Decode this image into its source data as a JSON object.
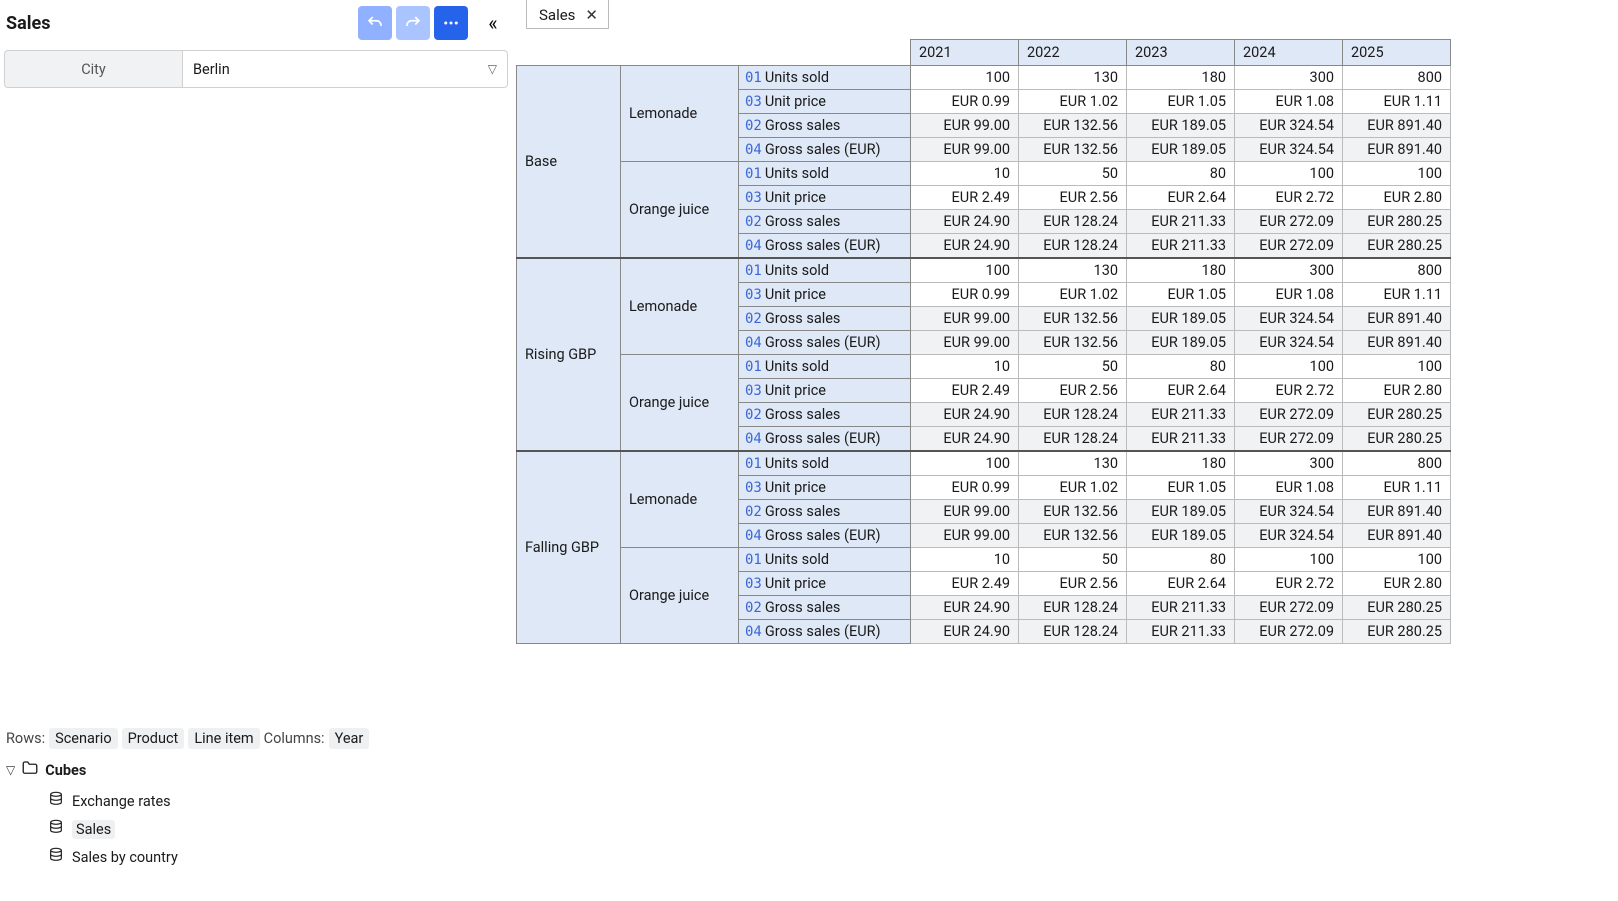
{
  "sidebar": {
    "title": "Sales",
    "filter": {
      "label": "City",
      "value": "Berlin"
    },
    "rows_label": "Rows:",
    "cols_label": "Columns:",
    "row_dims": [
      "Scenario",
      "Product",
      "Line item"
    ],
    "col_dims": [
      "Year"
    ],
    "tree": {
      "root": "Cubes",
      "items": [
        {
          "label": "Exchange rates",
          "selected": false
        },
        {
          "label": "Sales",
          "selected": true
        },
        {
          "label": "Sales by country",
          "selected": false
        }
      ]
    }
  },
  "tab": {
    "label": "Sales"
  },
  "years": [
    "2021",
    "2022",
    "2023",
    "2024",
    "2025"
  ],
  "line_items": [
    {
      "code": "01",
      "label": "Units sold",
      "style": "units"
    },
    {
      "code": "03",
      "label": "Unit price",
      "style": "price"
    },
    {
      "code": "02",
      "label": "Gross sales",
      "style": "calc"
    },
    {
      "code": "04",
      "label": "Gross sales (EUR)",
      "style": "calc"
    }
  ],
  "scenarios": [
    {
      "name": "Base",
      "products": [
        {
          "name": "Lemonade",
          "rows": [
            [
              "100",
              "130",
              "180",
              "300",
              "800"
            ],
            [
              "EUR 0.99",
              "EUR 1.02",
              "EUR 1.05",
              "EUR 1.08",
              "EUR 1.11"
            ],
            [
              "EUR 99.00",
              "EUR 132.56",
              "EUR 189.05",
              "EUR 324.54",
              "EUR 891.40"
            ],
            [
              "EUR 99.00",
              "EUR 132.56",
              "EUR 189.05",
              "EUR 324.54",
              "EUR 891.40"
            ]
          ]
        },
        {
          "name": "Orange juice",
          "rows": [
            [
              "10",
              "50",
              "80",
              "100",
              "100"
            ],
            [
              "EUR 2.49",
              "EUR 2.56",
              "EUR 2.64",
              "EUR 2.72",
              "EUR 2.80"
            ],
            [
              "EUR 24.90",
              "EUR 128.24",
              "EUR 211.33",
              "EUR 272.09",
              "EUR 280.25"
            ],
            [
              "EUR 24.90",
              "EUR 128.24",
              "EUR 211.33",
              "EUR 272.09",
              "EUR 280.25"
            ]
          ]
        }
      ]
    },
    {
      "name": "Rising GBP",
      "products": [
        {
          "name": "Lemonade",
          "rows": [
            [
              "100",
              "130",
              "180",
              "300",
              "800"
            ],
            [
              "EUR 0.99",
              "EUR 1.02",
              "EUR 1.05",
              "EUR 1.08",
              "EUR 1.11"
            ],
            [
              "EUR 99.00",
              "EUR 132.56",
              "EUR 189.05",
              "EUR 324.54",
              "EUR 891.40"
            ],
            [
              "EUR 99.00",
              "EUR 132.56",
              "EUR 189.05",
              "EUR 324.54",
              "EUR 891.40"
            ]
          ]
        },
        {
          "name": "Orange juice",
          "rows": [
            [
              "10",
              "50",
              "80",
              "100",
              "100"
            ],
            [
              "EUR 2.49",
              "EUR 2.56",
              "EUR 2.64",
              "EUR 2.72",
              "EUR 2.80"
            ],
            [
              "EUR 24.90",
              "EUR 128.24",
              "EUR 211.33",
              "EUR 272.09",
              "EUR 280.25"
            ],
            [
              "EUR 24.90",
              "EUR 128.24",
              "EUR 211.33",
              "EUR 272.09",
              "EUR 280.25"
            ]
          ]
        }
      ]
    },
    {
      "name": "Falling GBP",
      "products": [
        {
          "name": "Lemonade",
          "rows": [
            [
              "100",
              "130",
              "180",
              "300",
              "800"
            ],
            [
              "EUR 0.99",
              "EUR 1.02",
              "EUR 1.05",
              "EUR 1.08",
              "EUR 1.11"
            ],
            [
              "EUR 99.00",
              "EUR 132.56",
              "EUR 189.05",
              "EUR 324.54",
              "EUR 891.40"
            ],
            [
              "EUR 99.00",
              "EUR 132.56",
              "EUR 189.05",
              "EUR 324.54",
              "EUR 891.40"
            ]
          ]
        },
        {
          "name": "Orange juice",
          "rows": [
            [
              "10",
              "50",
              "80",
              "100",
              "100"
            ],
            [
              "EUR 2.49",
              "EUR 2.56",
              "EUR 2.64",
              "EUR 2.72",
              "EUR 2.80"
            ],
            [
              "EUR 24.90",
              "EUR 128.24",
              "EUR 211.33",
              "EUR 272.09",
              "EUR 280.25"
            ],
            [
              "EUR 24.90",
              "EUR 128.24",
              "EUR 211.33",
              "EUR 272.09",
              "EUR 280.25"
            ]
          ]
        }
      ]
    }
  ]
}
